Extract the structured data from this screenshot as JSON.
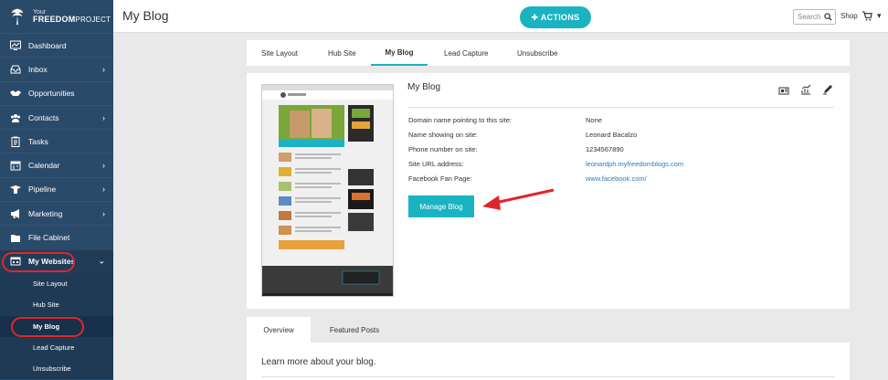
{
  "logo": {
    "small": "Your",
    "big": "FREEDOM",
    "big2": "PROJECT"
  },
  "sidebar": {
    "items": [
      {
        "label": "Dashboard",
        "icon": "dashboard-icon",
        "chevron": false
      },
      {
        "label": "Inbox",
        "icon": "inbox-icon",
        "chevron": true
      },
      {
        "label": "Opportunities",
        "icon": "handshake-icon",
        "chevron": false
      },
      {
        "label": "Contacts",
        "icon": "contacts-icon",
        "chevron": true
      },
      {
        "label": "Tasks",
        "icon": "clipboard-icon",
        "chevron": false
      },
      {
        "label": "Calendar",
        "icon": "calendar-icon",
        "chevron": true
      },
      {
        "label": "Pipeline",
        "icon": "funnel-icon",
        "chevron": true
      },
      {
        "label": "Marketing",
        "icon": "megaphone-icon",
        "chevron": true
      },
      {
        "label": "File Cabinet",
        "icon": "folder-icon",
        "chevron": false
      },
      {
        "label": "My Websites",
        "icon": "websites-icon",
        "chevron": true
      }
    ],
    "sub_items": [
      "Site Layout",
      "Hub Site",
      "My Blog",
      "Lead Capture",
      "Unsubscribe"
    ]
  },
  "topbar": {
    "title": "My Blog",
    "actions_label": "✚ ACTIONS",
    "search_placeholder": "Search",
    "shop_label": "Shop"
  },
  "tabs": [
    "Site Layout",
    "Hub Site",
    "My Blog",
    "Lead Capture",
    "Unsubscribe"
  ],
  "card": {
    "title": "My Blog",
    "rows": [
      {
        "label": "Domain name pointing to this site:",
        "value": "None",
        "link": false
      },
      {
        "label": "Name showing on site:",
        "value": "Leonard Bacalzo",
        "link": false
      },
      {
        "label": "Phone number on site:",
        "value": "1234567890",
        "link": false
      },
      {
        "label": "Site URL address:",
        "value": "leonardph.myfreedomblogs.com",
        "link": true
      },
      {
        "label": "Facebook Fan Page:",
        "value": "www.facebook.com/",
        "link": true
      }
    ],
    "manage_label": "Manage Blog"
  },
  "bottom": {
    "tabs": [
      "Overview",
      "Featured Posts"
    ],
    "learn_more": "Learn more about your blog."
  },
  "colors": {
    "accent": "#1ab3c2",
    "sidebar": "#2a4a6a",
    "highlight": "#e0262b",
    "link": "#2b7bbd"
  }
}
